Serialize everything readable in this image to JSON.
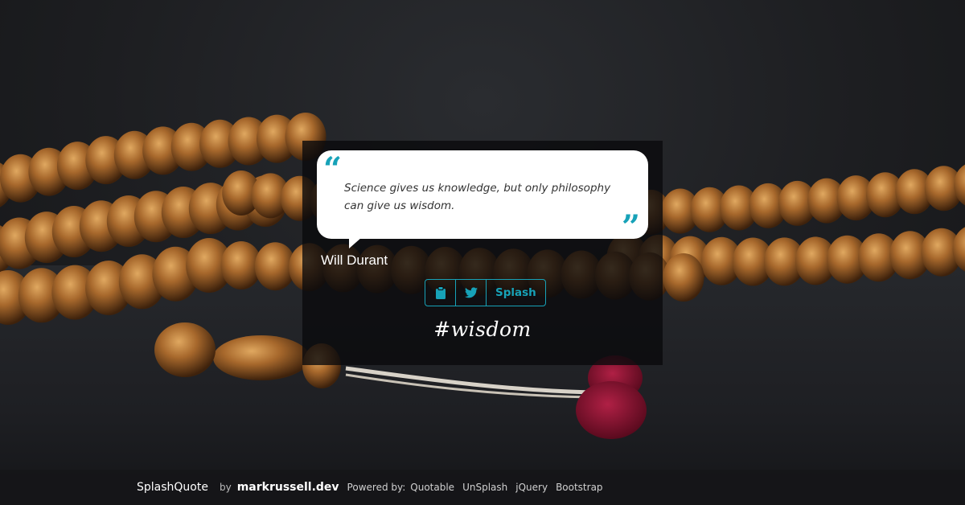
{
  "quote": {
    "text": "Science gives us knowledge, but only philosophy can give us wisdom.",
    "author": "Will Durant",
    "open_mark": "“",
    "close_mark": "”"
  },
  "actions": {
    "copy_icon": "clipboard-icon",
    "tweet_icon": "twitter-icon",
    "splash_label": "Splash"
  },
  "tag": "#wisdom",
  "footer": {
    "brand": "SplashQuote",
    "by": "by",
    "author": "markrussell.dev",
    "powered_by": "Powered by:",
    "links": [
      "Quotable",
      "UnSplash",
      "jQuery",
      "Bootstrap"
    ]
  },
  "colors": {
    "accent": "#17a2b8",
    "panel": "#0a0a0c",
    "bead": "#9a6228",
    "tassel": "#8a1430"
  }
}
